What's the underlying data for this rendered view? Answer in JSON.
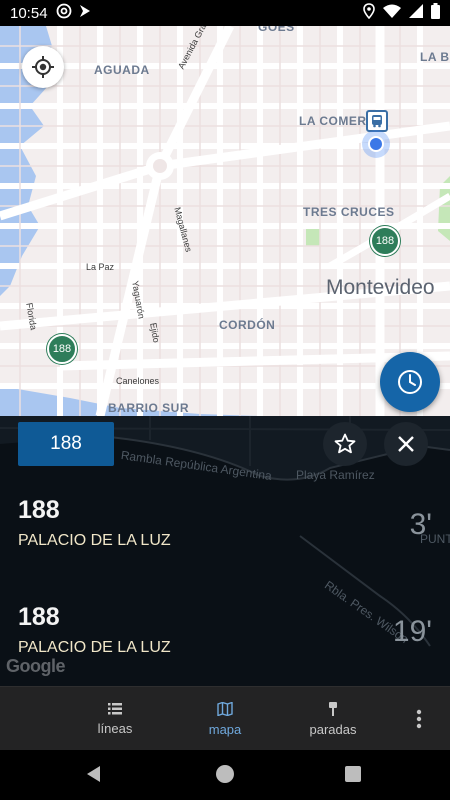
{
  "status_bar": {
    "time": "10:54",
    "left_icons": [
      "at-sign-icon",
      "flag-icon"
    ],
    "right_icons": [
      "location-icon",
      "wifi-icon",
      "signal-icon",
      "battery-icon"
    ]
  },
  "map": {
    "labels": {
      "aguada": "AGUADA",
      "la_comercial": "LA COMERC",
      "tres_cruces": "TRES CRUCES",
      "cordon": "CORDÓN",
      "barrio_sur": "BARRIO SUR",
      "la_blanqueada": "LA BL",
      "goes": "GOES",
      "montevideo": "Montevideo"
    },
    "streets": {
      "avenida_gral_flores": "Avenida Gral Flores",
      "magallanes": "Magallanes",
      "la_paz": "La Paz",
      "yaguaron": "Yaguarón",
      "ejido": "Ejido",
      "florida": "Florida",
      "canelones": "Canelones"
    },
    "markers": [
      {
        "label": "188"
      },
      {
        "label": "188"
      }
    ]
  },
  "panel": {
    "selected_line": "188",
    "background_labels": {
      "rambla": "Rambla República Argentina",
      "playa_ramirez": "Playa Ramírez",
      "rambla_wilson": "Rbla. Pres. Wilson",
      "punta": "PUNTA"
    },
    "arrivals": [
      {
        "line": "188",
        "destination": "PALACIO DE LA LUZ",
        "eta": "3'"
      },
      {
        "line": "188",
        "destination": "PALACIO DE LA LUZ",
        "eta": "19'"
      }
    ],
    "attribution": "Google"
  },
  "bottom_nav": {
    "items": [
      {
        "label": "líneas",
        "icon": "list-icon"
      },
      {
        "label": "mapa",
        "icon": "map-icon"
      },
      {
        "label": "paradas",
        "icon": "bus-stop-icon"
      }
    ],
    "active": "mapa"
  },
  "colors": {
    "accent": "#1565a8",
    "chip": "#0f5a96",
    "bus_marker": "#2e7d5a",
    "panel_bg": "#121a22",
    "nav_active": "#6fa8dc"
  }
}
